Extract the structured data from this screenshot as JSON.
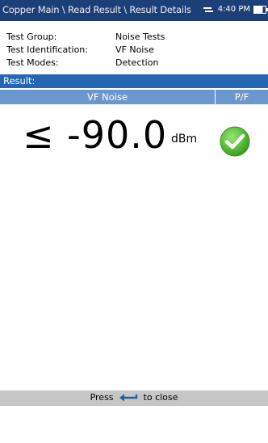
{
  "header": {
    "breadcrumb": "Copper Main \\ Read Result \\ Result Details",
    "time": "4:40 PM"
  },
  "info": {
    "test_group_label": "Test Group:",
    "test_group_value": "Noise Tests",
    "test_id_label": "Test Identification:",
    "test_id_value": "VF Noise",
    "test_modes_label": "Test Modes:",
    "test_modes_value": "Detection"
  },
  "result": {
    "section_label": "Result:",
    "col_measure": "VF Noise",
    "col_pf": "P/F",
    "value": "≤ -90.0",
    "unit": "dBm",
    "status": "pass"
  },
  "footer": {
    "press_text": "Press",
    "close_text": "to close"
  },
  "icons": {
    "usb": "usb-icon",
    "battery": "battery-icon",
    "pass": "pass-check-icon",
    "enter": "enter-key-icon"
  },
  "colors": {
    "title_bar": "#1d3f77",
    "result_bar": "#2466b3",
    "column_header": "#6b97cf",
    "pass_green": "#5cc23a",
    "footer": "#c6c6c6",
    "enter_key": "#1f5ea8"
  }
}
